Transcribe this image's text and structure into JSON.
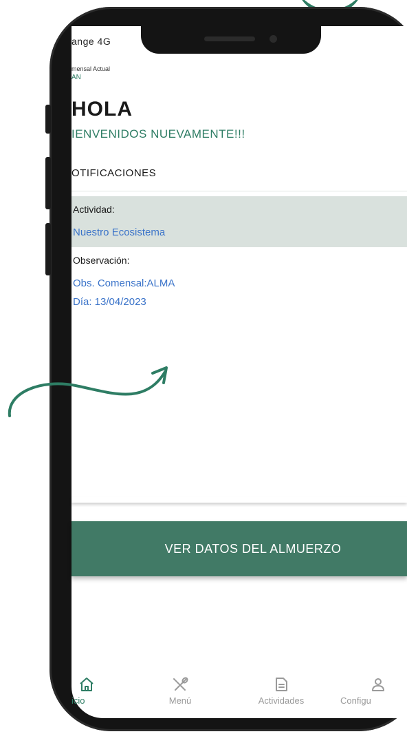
{
  "status_bar": {
    "carrier": "ange 4G"
  },
  "header": {
    "comensal_label": "mensal Actual",
    "comensal_name": "AN",
    "greeting": "HOLA",
    "welcome": "IENVENIDOS NUEVAMENTE!!!"
  },
  "notifications": {
    "title": "OTIFICACIONES",
    "activity_label": "Actividad:",
    "activity_value": "Nuestro Ecosistema",
    "observation_label": "Observación:",
    "observation_value": "Obs. Comensal:ALMA",
    "observation_date": "Día: 13/04/2023"
  },
  "actions": {
    "lunch_button": "VER DATOS DEL ALMUERZO"
  },
  "tab_bar": [
    {
      "label": "icio",
      "icon": "home-icon",
      "active": true
    },
    {
      "label": "Menú",
      "icon": "utensils-icon",
      "active": false
    },
    {
      "label": "Actividades",
      "icon": "document-icon",
      "active": false
    },
    {
      "label": "Configu",
      "icon": "user-icon",
      "active": false
    }
  ],
  "colors": {
    "accent": "#2e7d64",
    "button": "#417a66",
    "link": "#3a73c9",
    "band": "#d9e1dd"
  }
}
